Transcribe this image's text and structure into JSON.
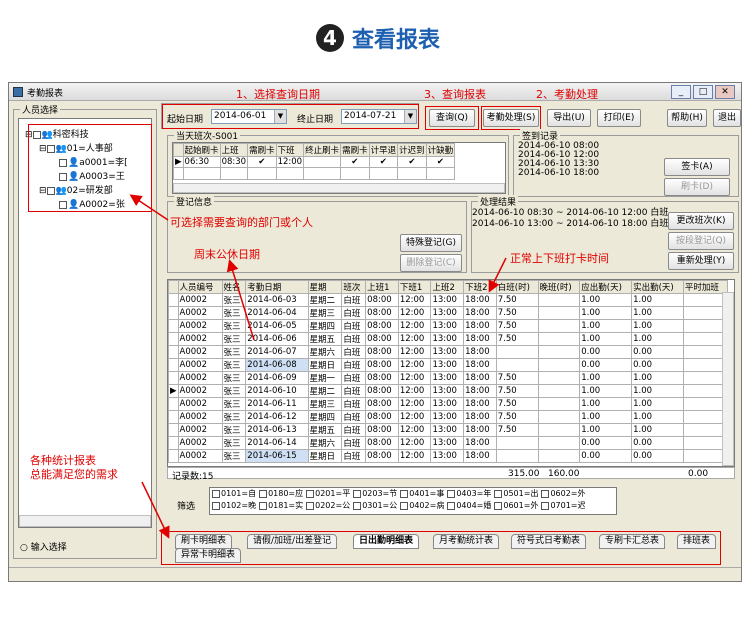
{
  "header": {
    "badge": "4",
    "title": "查看报表"
  },
  "window": {
    "title": "考勤报表"
  },
  "left_panel": {
    "label": "人员选择",
    "tree": [
      "科密科技",
      "01=人事部",
      "a0001=李[",
      "A0003=王",
      "02=研发部",
      "A0002=张"
    ],
    "input_select": "输入选择"
  },
  "query": {
    "start_label": "起始日期",
    "start_value": "2014-06-01",
    "end_label": "终止日期",
    "end_value": "2014-07-21"
  },
  "toolbar": {
    "query": "查询(Q)",
    "process": "考勤处理(S)",
    "export": "导出(U)",
    "print": "打印(E)",
    "help": "帮助(H)",
    "exit": "退出"
  },
  "annotations": {
    "a1": "1、选择查询日期",
    "a2": "2、考勤处理",
    "a3": "3、查询报表",
    "dept": "可选择需要查询的部门或个人",
    "weekend": "周末公休日期",
    "normal": "正常上下班打卡时间",
    "reports1": "各种统计报表",
    "reports2": "总能满足您的需求"
  },
  "shift": {
    "label": "当天班次-S001",
    "headers": [
      "起始刷卡",
      "上班",
      "需刷卡",
      "下班",
      "终止刷卡",
      "需刷卡",
      "计早退",
      "计迟到",
      "计缺勤"
    ],
    "row": [
      "06:30",
      "08:30",
      "✔",
      "12:00",
      "",
      "✔",
      "✔",
      "✔",
      "✔"
    ]
  },
  "sign": {
    "label": "签到记录",
    "records": [
      "2014-06-10 08:00",
      "2014-06-10 12:00",
      "2014-06-10 13:30",
      "2014-06-10 18:00"
    ],
    "sign_btn": "签卡(A)",
    "card_btn": "刷卡(D)"
  },
  "reg": {
    "label": "登记信息",
    "special": "特殊登记(G)",
    "delete": "删除登记(C)"
  },
  "result": {
    "label": "处理结果",
    "lines": [
      "2014-06-10 08:30 ~ 2014-06-10 12:00 白班",
      "2014-06-10 13:00 ~ 2014-06-10 18:00 白班"
    ],
    "change": "更改班次(K)",
    "by_shift": "按段登记(Q)",
    "reprocess": "重新处理(Y)"
  },
  "grid": {
    "headers": [
      "人员编号",
      "姓名",
      "考勤日期",
      "星期",
      "班次",
      "上班1",
      "下班1",
      "上班2",
      "下班2",
      "白班(时)",
      "晚班(时)",
      "应出勤(天)",
      "实出勤(天)",
      "平时加班"
    ],
    "rows": [
      [
        "A0002",
        "张三",
        "2014-06-03",
        "星期二",
        "白班",
        "08:00",
        "12:00",
        "13:00",
        "18:00",
        "7.50",
        "",
        "1.00",
        "1.00",
        ""
      ],
      [
        "A0002",
        "张三",
        "2014-06-04",
        "星期三",
        "白班",
        "08:00",
        "12:00",
        "13:00",
        "18:00",
        "7.50",
        "",
        "1.00",
        "1.00",
        ""
      ],
      [
        "A0002",
        "张三",
        "2014-06-05",
        "星期四",
        "白班",
        "08:00",
        "12:00",
        "13:00",
        "18:00",
        "7.50",
        "",
        "1.00",
        "1.00",
        ""
      ],
      [
        "A0002",
        "张三",
        "2014-06-06",
        "星期五",
        "白班",
        "08:00",
        "12:00",
        "13:00",
        "18:00",
        "7.50",
        "",
        "1.00",
        "1.00",
        ""
      ],
      [
        "A0002",
        "张三",
        "2014-06-07",
        "星期六",
        "白班",
        "08:00",
        "12:00",
        "13:00",
        "18:00",
        "",
        "",
        "0.00",
        "0.00",
        ""
      ],
      [
        "A0002",
        "张三",
        "2014-06-08",
        "星期日",
        "白班",
        "08:00",
        "12:00",
        "13:00",
        "18:00",
        "",
        "",
        "0.00",
        "0.00",
        ""
      ],
      [
        "A0002",
        "张三",
        "2014-06-09",
        "星期一",
        "白班",
        "08:00",
        "12:00",
        "13:00",
        "18:00",
        "7.50",
        "",
        "1.00",
        "1.00",
        ""
      ],
      [
        "A0002",
        "张三",
        "2014-06-10",
        "星期二",
        "白班",
        "08:00",
        "12:00",
        "13:00",
        "18:00",
        "7.50",
        "",
        "1.00",
        "1.00",
        ""
      ],
      [
        "A0002",
        "张三",
        "2014-06-11",
        "星期三",
        "白班",
        "08:00",
        "12:00",
        "13:00",
        "18:00",
        "7.50",
        "",
        "1.00",
        "1.00",
        ""
      ],
      [
        "A0002",
        "张三",
        "2014-06-12",
        "星期四",
        "白班",
        "08:00",
        "12:00",
        "13:00",
        "18:00",
        "7.50",
        "",
        "1.00",
        "1.00",
        ""
      ],
      [
        "A0002",
        "张三",
        "2014-06-13",
        "星期五",
        "白班",
        "08:00",
        "12:00",
        "13:00",
        "18:00",
        "7.50",
        "",
        "1.00",
        "1.00",
        ""
      ],
      [
        "A0002",
        "张三",
        "2014-06-14",
        "星期六",
        "白班",
        "08:00",
        "12:00",
        "13:00",
        "18:00",
        "",
        "",
        "0.00",
        "0.00",
        ""
      ],
      [
        "A0002",
        "张三",
        "2014-06-15",
        "星期日",
        "白班",
        "08:00",
        "12:00",
        "13:00",
        "18:00",
        "",
        "",
        "0.00",
        "0.00",
        ""
      ]
    ],
    "footer": {
      "label": "记录数:15",
      "bai": "315.00",
      "wan": "160.00",
      "shi": "0.00"
    }
  },
  "filter": {
    "label": "筛选",
    "row1": [
      "0101=自",
      "0180=应",
      "0201=平",
      "0203=节",
      "0401=事",
      "0403=年",
      "0501=出",
      "0602=外"
    ],
    "row2": [
      "0102=晚",
      "0181=实",
      "0202=公",
      "0301=公",
      "0402=病",
      "0404=婚",
      "0601=外",
      "0701=迟"
    ]
  },
  "tabs": [
    "刷卡明细表",
    "请假/加班/出差登记",
    "日出勤明细表",
    "月考勤统计表",
    "符号式日考勤表",
    "专刷卡汇总表",
    "排班表",
    "异常卡明细表"
  ]
}
